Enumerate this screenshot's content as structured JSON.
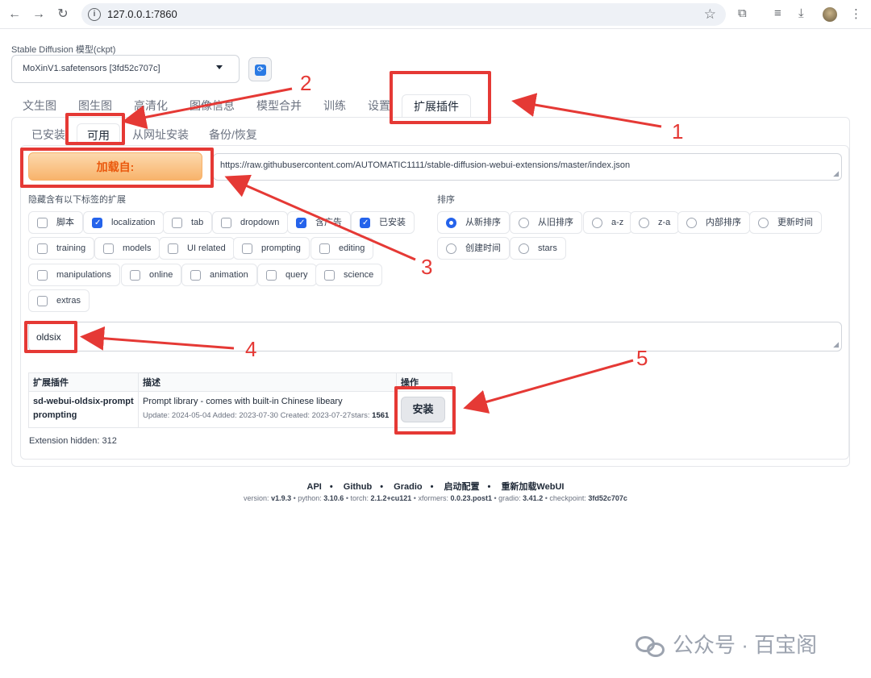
{
  "browser": {
    "url": "127.0.0.1:7860"
  },
  "model": {
    "label": "Stable Diffusion 模型(ckpt)",
    "value": "MoXinV1.safetensors [3fd52c707c]"
  },
  "main_tabs": [
    {
      "label": "文生图"
    },
    {
      "label": "图生图"
    },
    {
      "label": "高清化"
    },
    {
      "label": "图像信息"
    },
    {
      "label": "模型合并"
    },
    {
      "label": "训练"
    },
    {
      "label": "设置"
    },
    {
      "label": "扩展插件"
    }
  ],
  "sub_tabs": [
    {
      "label": "已安装"
    },
    {
      "label": "可用"
    },
    {
      "label": "从网址安装"
    },
    {
      "label": "备份/恢复"
    }
  ],
  "load_from": {
    "button_label": "加载自:",
    "url": "https://raw.githubusercontent.com/AUTOMATIC1111/stable-diffusion-webui-extensions/master/index.json"
  },
  "hide_tags": {
    "label": "隐藏含有以下标签的扩展",
    "items": [
      {
        "label": "脚本",
        "checked": false
      },
      {
        "label": "localization",
        "checked": true
      },
      {
        "label": "tab",
        "checked": false
      },
      {
        "label": "dropdown",
        "checked": false
      },
      {
        "label": "含广告",
        "checked": true
      },
      {
        "label": "已安装",
        "checked": true
      },
      {
        "label": "training",
        "checked": false
      },
      {
        "label": "models",
        "checked": false
      },
      {
        "label": "UI related",
        "checked": false
      },
      {
        "label": "prompting",
        "checked": false
      },
      {
        "label": "editing",
        "checked": false
      },
      {
        "label": "manipulations",
        "checked": false
      },
      {
        "label": "online",
        "checked": false
      },
      {
        "label": "animation",
        "checked": false
      },
      {
        "label": "query",
        "checked": false
      },
      {
        "label": "science",
        "checked": false
      },
      {
        "label": "extras",
        "checked": false
      }
    ]
  },
  "sort": {
    "label": "排序",
    "items": [
      {
        "label": "从新排序",
        "selected": true
      },
      {
        "label": "从旧排序",
        "selected": false
      },
      {
        "label": "a-z",
        "selected": false
      },
      {
        "label": "z-a",
        "selected": false
      },
      {
        "label": "内部排序",
        "selected": false
      },
      {
        "label": "更新时间",
        "selected": false
      },
      {
        "label": "创建时间",
        "selected": false
      },
      {
        "label": "stars",
        "selected": false
      }
    ]
  },
  "search": {
    "value": "oldsix"
  },
  "table": {
    "headers": [
      "扩展插件",
      "描述",
      "操作"
    ],
    "rows": [
      {
        "name": "sd-webui-oldsix-prompt",
        "tag": "prompting",
        "description": "Prompt library - comes with built-in Chinese libeary",
        "meta_prefix": "Update: 2024-05-04 Added: 2023-07-30 Created: 2023-07-27stars: ",
        "stars": "1561",
        "action": "安装"
      }
    ]
  },
  "hidden_count": "Extension hidden: 312",
  "footer": {
    "links": [
      "API",
      "Github",
      "Gradio",
      "启动配置",
      "重新加载WebUI"
    ],
    "version_line": [
      {
        "k": "version: ",
        "v": "v1.9.3"
      },
      {
        "k": "python: ",
        "v": "3.10.6"
      },
      {
        "k": "torch: ",
        "v": "2.1.2+cu121"
      },
      {
        "k": "xformers: ",
        "v": "0.0.23.post1"
      },
      {
        "k": "gradio: ",
        "v": "3.41.2"
      },
      {
        "k": "checkpoint: ",
        "v": "3fd52c707c"
      }
    ]
  },
  "annotations": {
    "numbers": [
      "1",
      "2",
      "3",
      "4",
      "5"
    ],
    "color": "#e53935"
  },
  "watermark": "公众号 · 百宝阁",
  "colors": {
    "primary": "#2563eb",
    "load_button": "#f8b36b",
    "load_text": "#ea580c"
  }
}
